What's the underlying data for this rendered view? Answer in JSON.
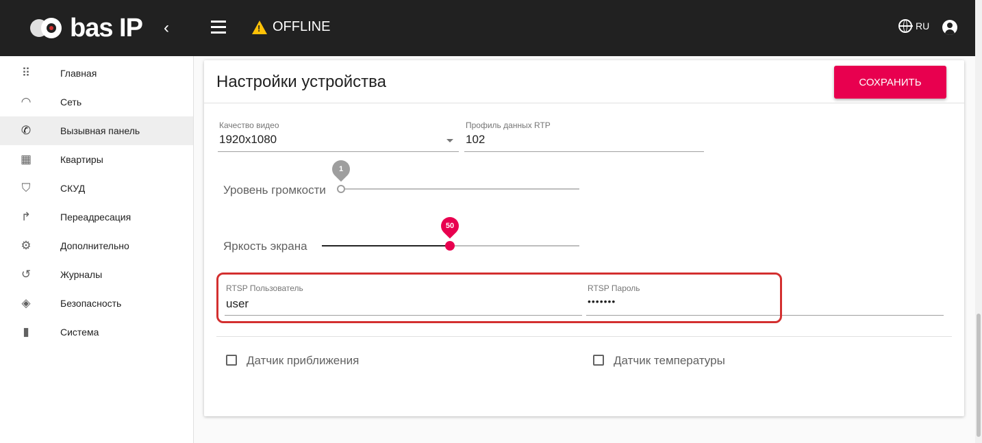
{
  "header": {
    "logo_text": "bas IP",
    "status_text": "OFFLINE",
    "language": "RU",
    "collapse_glyph": "‹"
  },
  "sidebar": {
    "items": [
      {
        "label": "Главная",
        "icon": "apps-icon"
      },
      {
        "label": "Сеть",
        "icon": "wifi-icon"
      },
      {
        "label": "Вызывная панель",
        "icon": "phone-icon"
      },
      {
        "label": "Квартиры",
        "icon": "building-icon"
      },
      {
        "label": "СКУД",
        "icon": "shield-icon"
      },
      {
        "label": "Переадресация",
        "icon": "call-forward-icon"
      },
      {
        "label": "Дополнительно",
        "icon": "gear-icon"
      },
      {
        "label": "Журналы",
        "icon": "history-icon"
      },
      {
        "label": "Безопасность",
        "icon": "security-icon"
      },
      {
        "label": "Система",
        "icon": "device-icon"
      }
    ],
    "active_index": 2
  },
  "card": {
    "title": "Настройки устройства",
    "save_label": "СОХРАНИТЬ",
    "video_quality": {
      "label": "Качество видео",
      "value": "1920x1080"
    },
    "rtp_profile": {
      "label": "Профиль данных RTP",
      "value": "102"
    },
    "volume": {
      "label": "Уровень громкости",
      "value": "1"
    },
    "brightness": {
      "label": "Яркость экрана",
      "value": "50"
    },
    "rtsp_user": {
      "label": "RTSP Пользователь",
      "value": "user"
    },
    "rtsp_password": {
      "label": "RTSP Пароль",
      "value": "•••••••"
    },
    "proximity_sensor": {
      "label": "Датчик приближения",
      "checked": false
    },
    "temperature_sensor": {
      "label": "Датчик температуры",
      "checked": false
    }
  },
  "colors": {
    "accent": "#e8004f",
    "topbar": "#212121",
    "warning": "#ffc107"
  }
}
